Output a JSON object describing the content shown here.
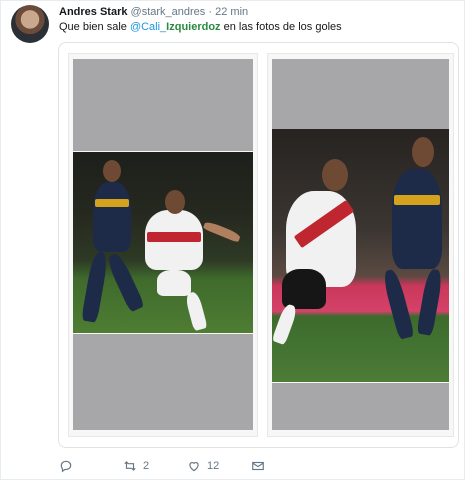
{
  "tweet": {
    "author_name": "Andres Stark",
    "handle": "@stark_andres",
    "separator": "·",
    "time": "22 min",
    "text_before": "Que bien sale ",
    "mention_prefix": "@Cali_",
    "mention_bold": "Izquierdoz",
    "text_after": " en las fotos de los goles"
  },
  "actions": {
    "reply_count": "",
    "retweet_count": "2",
    "like_count": "12"
  },
  "colors": {
    "link": "#1b95e0",
    "meta": "#657786",
    "gray_bar": "#a7a7a9"
  },
  "icons": [
    "reply-icon",
    "retweet-icon",
    "like-icon",
    "message-icon"
  ]
}
